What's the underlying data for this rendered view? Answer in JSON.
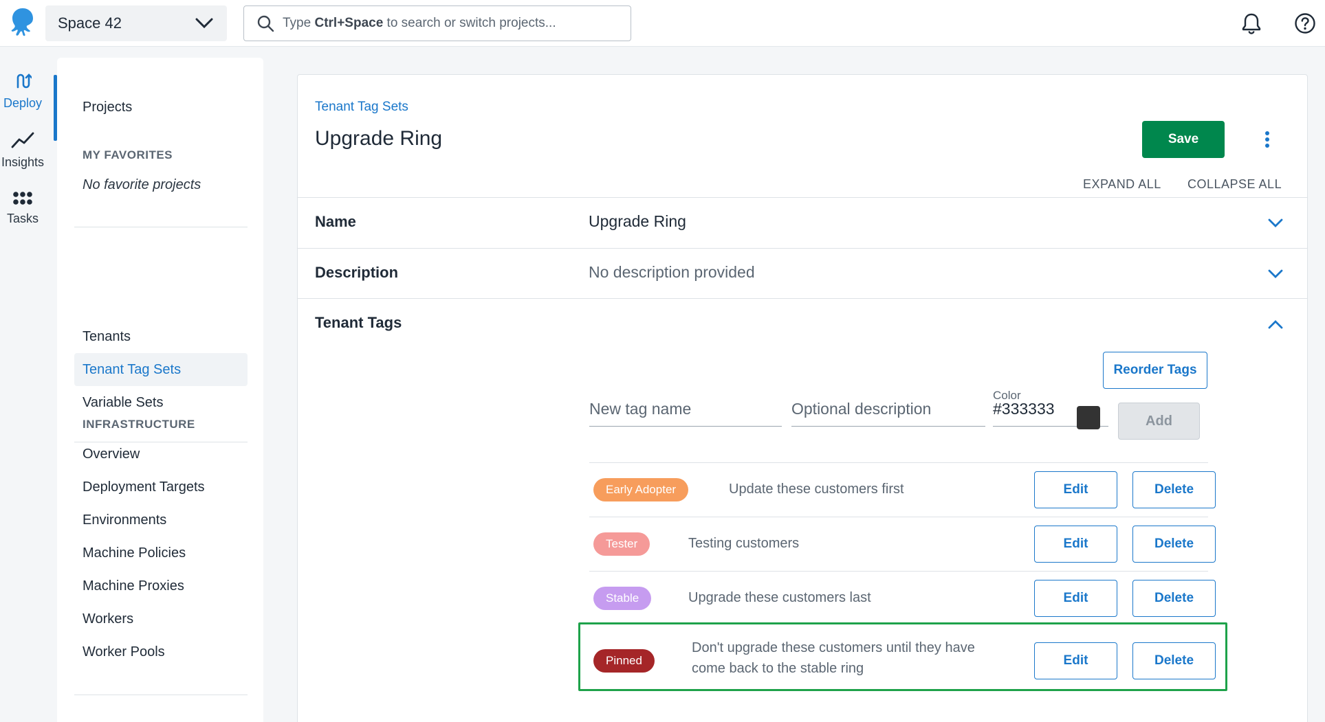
{
  "topbar": {
    "space_name": "Space 42",
    "search_placeholder_pre": "Type ",
    "search_placeholder_key": "Ctrl+Space",
    "search_placeholder_post": " to search or switch projects..."
  },
  "rail": {
    "items": [
      {
        "label": "Deploy",
        "icon": "deploy-icon"
      },
      {
        "label": "Insights",
        "icon": "chart-line-icon"
      },
      {
        "label": "Tasks",
        "icon": "tasks-icon"
      }
    ],
    "active_color": "#1a77ca"
  },
  "sidebar": {
    "projects": "Projects",
    "favorites_heading": "MY FAVORITES",
    "favorites_empty": "No favorite projects",
    "tenant_items": [
      "Tenants",
      "Tenant Tag Sets",
      "Variable Sets"
    ],
    "infra_heading": "INFRASTRUCTURE",
    "infra_items": [
      "Overview",
      "Deployment Targets",
      "Environments",
      "Machine Policies",
      "Machine Proxies",
      "Workers",
      "Worker Pools"
    ]
  },
  "page": {
    "breadcrumb": "Tenant Tag Sets",
    "title": "Upgrade Ring",
    "save_label": "Save",
    "expand_all": "EXPAND ALL",
    "collapse_all": "COLLAPSE ALL",
    "name_label": "Name",
    "name_value": "Upgrade Ring",
    "description_label": "Description",
    "description_value": "No description provided",
    "tags_label": "Tenant Tags",
    "reorder_label": "Reorder Tags",
    "new_tag_placeholder": "New tag name",
    "desc_placeholder": "Optional description",
    "color_label": "Color",
    "color_value": "#333333",
    "add_label": "Add",
    "edit_label": "Edit",
    "delete_label": "Delete",
    "save_color": "#00874d"
  },
  "tags": [
    {
      "name": "Early Adopter",
      "description": "Update these customers first",
      "color": "#f79d5c"
    },
    {
      "name": "Tester",
      "description": "Testing customers",
      "color": "#f59a98"
    },
    {
      "name": "Stable",
      "description": "Upgrade these customers last",
      "color": "#c69cf0"
    },
    {
      "name": "Pinned",
      "description_line1": "Don't upgrade these customers until they have",
      "description_line2": "come back to the stable ring",
      "color": "#a52628"
    }
  ]
}
